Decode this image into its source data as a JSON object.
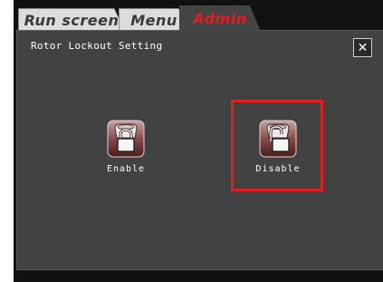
{
  "tabs": [
    {
      "label": "Run screen",
      "active": false
    },
    {
      "label": "Menu",
      "active": false
    },
    {
      "label": "Admin",
      "active": true
    }
  ],
  "dialog": {
    "title": "Rotor Lockout Setting",
    "close_icon": "close-icon"
  },
  "options": {
    "enable": {
      "label": "Enable",
      "icon": "rotor-lock-icon"
    },
    "disable": {
      "label": "Disable",
      "icon": "rotor-unlock-icon",
      "highlighted": true
    }
  },
  "colors": {
    "accent": "#e31b23",
    "panel": "#424242",
    "highlight": "#e02020"
  }
}
